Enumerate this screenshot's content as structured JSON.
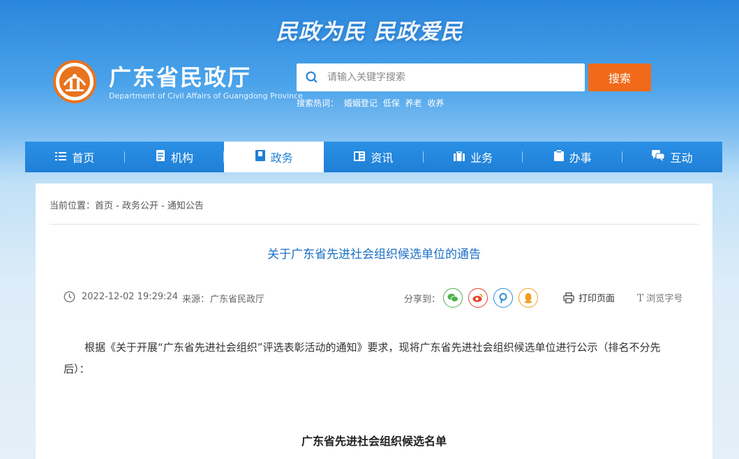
{
  "header": {
    "slogan": "民政为民  民政爱民",
    "site_title": "广东省民政厅",
    "site_subtitle": "Department of Civil Affairs of Guangdong Province"
  },
  "search": {
    "placeholder": "请输入关键字搜索",
    "button_label": "搜索",
    "hot_label": "搜索热词：",
    "hot_terms": [
      "婚姻登记",
      "低保",
      "养老",
      "收养"
    ]
  },
  "nav": {
    "items": [
      {
        "label": "首页",
        "icon": "list-icon"
      },
      {
        "label": "机构",
        "icon": "document-icon"
      },
      {
        "label": "政务",
        "icon": "book-icon",
        "active": true
      },
      {
        "label": "资讯",
        "icon": "news-icon"
      },
      {
        "label": "业务",
        "icon": "briefcase-icon"
      },
      {
        "label": "办事",
        "icon": "clipboard-icon"
      },
      {
        "label": "互动",
        "icon": "chat-icon"
      }
    ]
  },
  "breadcrumb": {
    "text": "当前位置：首页 - 政务公开 - 通知公告"
  },
  "article": {
    "title": "关于广东省先进社会组织候选单位的通告",
    "date": "2022-12-02 19:29:24",
    "source_label": "来源：",
    "source": "广东省民政厅",
    "share_label": "分享到：",
    "share_icons": [
      "wechat-icon",
      "weibo-icon",
      "pinterest-icon",
      "qq-icon"
    ],
    "print_label": "打印页面",
    "font_label": "浏览字号",
    "paragraph": "根据《关于开展“广东省先进社会组织”评选表彰活动的通知》要求，现将广东省先进社会组织候选单位进行公示（排名不分先后）：",
    "list_title": "广东省先进社会组织候选名单"
  },
  "colors": {
    "nav_bg": "#1f7fd6",
    "search_button": "#f06a1a",
    "title_blue": "#1b6fc4",
    "emblem_orange": "#e9731e"
  }
}
